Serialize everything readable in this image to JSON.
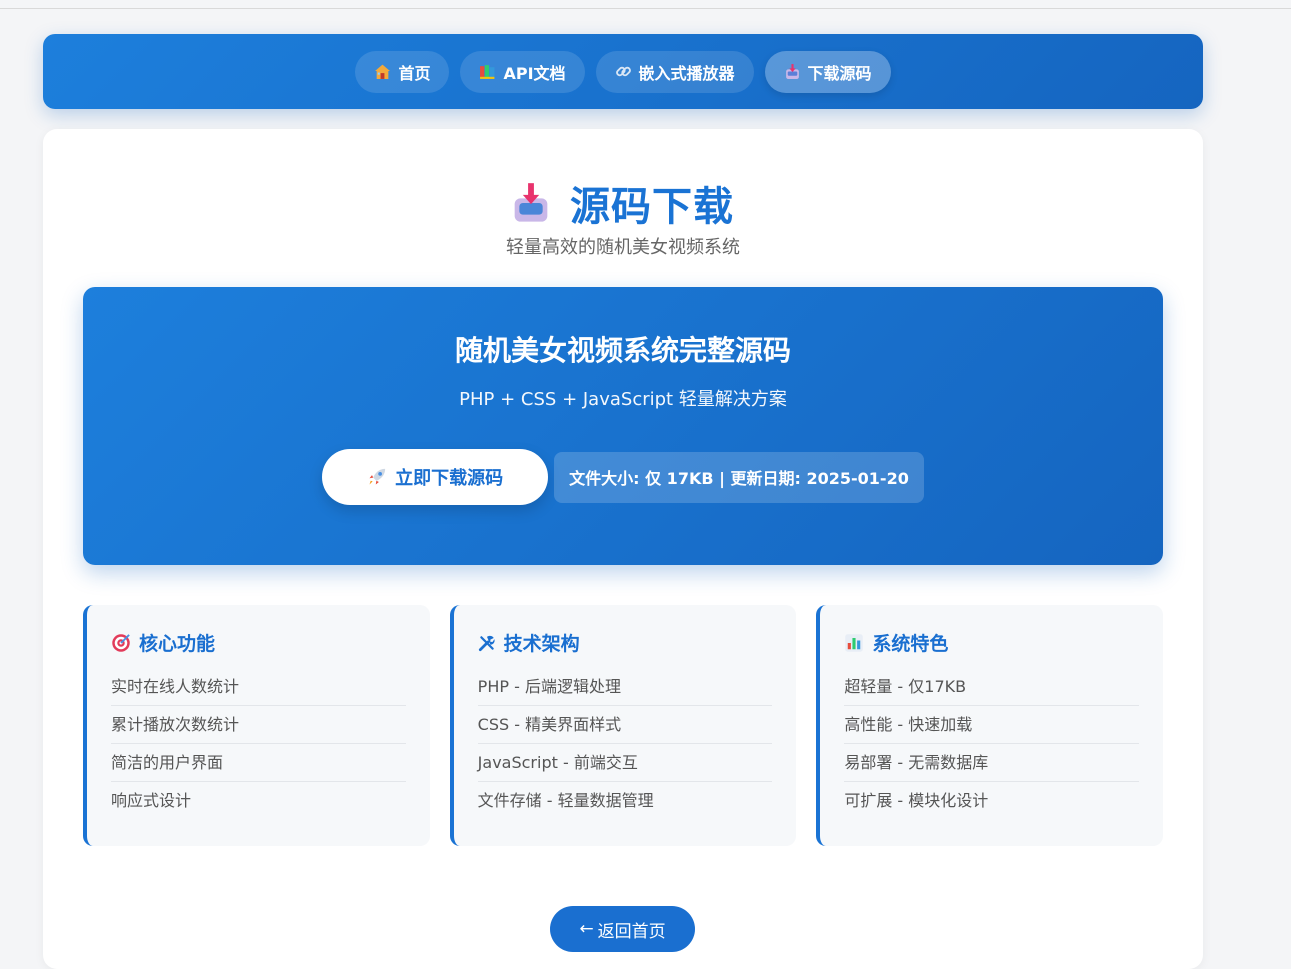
{
  "nav": {
    "items": [
      {
        "label": "首页",
        "icon": "house-icon"
      },
      {
        "label": "API文档",
        "icon": "books-icon"
      },
      {
        "label": "嵌入式播放器",
        "icon": "link-icon"
      },
      {
        "label": "下载源码",
        "icon": "inbox-tray-icon",
        "active": true
      }
    ]
  },
  "header": {
    "title": "源码下载",
    "subtitle": "轻量高效的随机美女视频系统",
    "icon": "inbox-tray-icon"
  },
  "hero": {
    "title": "随机美女视频系统完整源码",
    "subtitle": "PHP + CSS + JavaScript 轻量解决方案",
    "download_label": "立即下载源码",
    "download_icon": "rocket-icon",
    "file_info": "文件大小: 仅 17KB | 更新日期: 2025-01-20"
  },
  "features": [
    {
      "title": "核心功能",
      "icon": "target-icon",
      "items": [
        "实时在线人数统计",
        "累计播放次数统计",
        "简洁的用户界面",
        "响应式设计"
      ]
    },
    {
      "title": "技术架构",
      "icon": "tools-icon",
      "items": [
        "PHP - 后端逻辑处理",
        "CSS - 精美界面样式",
        "JavaScript - 前端交互",
        "文件存储 - 轻量数据管理"
      ]
    },
    {
      "title": "系统特色",
      "icon": "bar-chart-icon",
      "items": [
        "超轻量 - 仅17KB",
        "高性能 - 快速加载",
        "易部署 - 无需数据库",
        "可扩展 - 模块化设计"
      ]
    }
  ],
  "back": {
    "arrow": "←",
    "label": "返回首页"
  },
  "colors": {
    "accent": "#1a73d4",
    "gradient_start": "#1d7fdc",
    "gradient_end": "#1565c0"
  }
}
